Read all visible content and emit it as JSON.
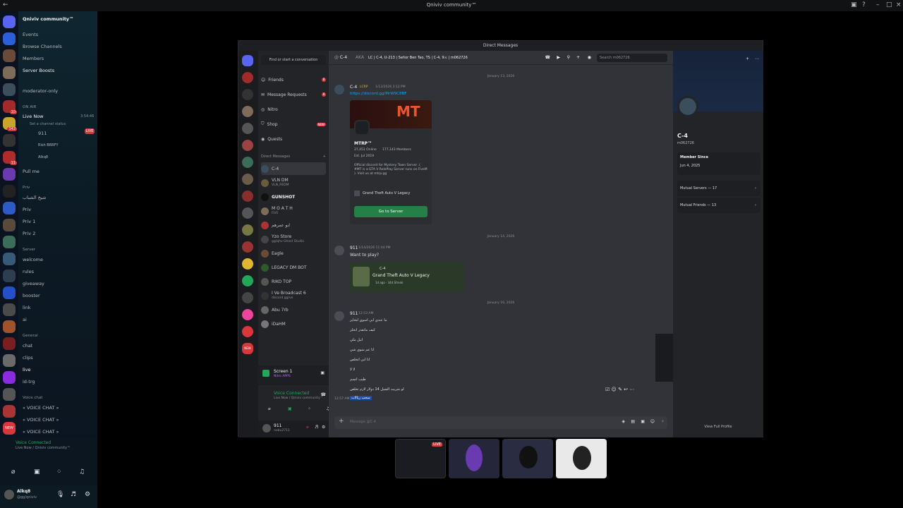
{
  "app": {
    "title": "Qniviv community™"
  },
  "server": {
    "name": "Qniviv community™"
  },
  "sidebar": {
    "top": [
      "Events",
      "Browse Channels",
      "Members",
      "Server Boosts"
    ],
    "boosts_badge": "1",
    "moderator": "moderator-only",
    "on_air_label": "ON AIR",
    "live_now": "Live Now",
    "live_time": "3:54:46",
    "set_status": "Set a channel status",
    "live_users": [
      "911",
      "Rish BRRFY",
      "Alkq8"
    ],
    "live_tag": "LIVE",
    "pull": "Pull me",
    "priv_label": "Priv",
    "priv_items": [
      "شيخ الشباب",
      "Priv",
      "Priv 1",
      "Priv 2"
    ],
    "server_label": "Server",
    "server_items": [
      "welcome",
      "rules",
      "giveaway",
      "booster",
      "link",
      "ai"
    ],
    "general_label": "General",
    "general_items": [
      "chat",
      "clips",
      "live",
      "id-trg"
    ],
    "voice_label": "Voice chat",
    "voice_items": [
      "« VOICE CHAT »",
      "« VOICE CHAT »",
      "« VOICE CHAT »"
    ],
    "new_badge": "NEW"
  },
  "voice_status": {
    "title": "Voice Connected",
    "sub": "Live Now / Qniviv community™"
  },
  "userbar": {
    "name": "Alkq8",
    "status": "@gg/qniviv"
  },
  "window": {
    "title": "Direct Messages"
  },
  "dm": {
    "search": "Find or start a conversation",
    "menu": [
      "Friends",
      "Message Requests",
      "Nitro",
      "Shop",
      "Quests"
    ],
    "shop_badge": "NEW",
    "friends_badge": "8",
    "requests_badge": "8",
    "dm_label": "Direct Messages",
    "items": [
      {
        "name": "C-4",
        "sub": ""
      },
      {
        "name": "VLN DM",
        "sub": "VLN_REDM"
      },
      {
        "name": "GUNSHOT",
        "sub": ""
      },
      {
        "name": "M O A T H",
        "sub": "FiVE"
      },
      {
        "name": "ابو عمرهم",
        "sub": ""
      },
      {
        "name": "Yzo Store",
        "sub": "gg/qhv Ghost Studio"
      },
      {
        "name": "Eagle",
        "sub": ""
      },
      {
        "name": "LEGACY DM BOT",
        "sub": ""
      },
      {
        "name": "RIKO TOP",
        "sub": ""
      },
      {
        "name": "I Ve Broadcast 6",
        "sub": "discord.gg/ve"
      },
      {
        "name": "Abu 7rb",
        "sub": ""
      },
      {
        "name": "iDaHM",
        "sub": ""
      }
    ],
    "screen_share": {
      "title": "Screen 1",
      "sub": "Nitro APPS"
    },
    "voice": {
      "title": "Voice Connected",
      "sub": "Live Now / Qniviv community™"
    },
    "me": {
      "name": "911",
      "tag": "nebu2711"
    }
  },
  "chat": {
    "header": {
      "name": "C-4",
      "aka": "AKA",
      "nicks": "LC | C-4, U-213 | Señor Ben Tao, TS | C-4, 9⚔ | m062726",
      "search": "Search m062726"
    },
    "dates": [
      "January 13, 2026",
      "January 14, 2026",
      "January 16, 2026"
    ],
    "m1": {
      "author": "C-4",
      "tag": "LCRP",
      "time": "1/13/2026 3:12 PM",
      "link": "https://discord.gg/MrW9C8BF"
    },
    "invite": {
      "banner": "MT",
      "name": "MTRP™",
      "online": "27,451 Online",
      "members": "177,143 Members",
      "est": "Est. Jul 2019",
      "desc": "Official discord for Mystery Town Server .( #MT is a GTA V RolePlay Server runs on FiveM ). Visit us at mtrp.gg",
      "game": "Grand Theft Auto V Legacy",
      "button": "Go to Server"
    },
    "m2": {
      "author": "911",
      "time": "1/14/2026 11:44 PM",
      "text": "Want to play?"
    },
    "activity": {
      "user": "C-4",
      "game": "Grand Theft Auto V Legacy",
      "meta": "1d ago · 34d Streak"
    },
    "m3": {
      "author": "911",
      "time": "12:53 AM",
      "lines": [
        "ما عندي ابي اسوي لتخايز",
        "كيف ماتقدر انخلز",
        "ابيل ملي",
        "انا عم سوي شي",
        "انا ابي اتخلص",
        "لا لا",
        "طيب انسم",
        "لو شريت الشيل 14 دولار لازم تخلص"
      ]
    },
    "m4": {
      "time": "12:57 AM",
      "text": "سحب ريالات"
    },
    "input_placeholder": "Message @C-4"
  },
  "profile": {
    "name": "C-4",
    "username": "m062726",
    "member_since_label": "Member Since",
    "member_since": "Jun 4, 2025",
    "mutual_servers": "Mutual Servers — 17",
    "mutual_friends": "Mutual Friends — 13",
    "view_full": "View Full Profile"
  },
  "dock": {
    "live": "LIVE"
  },
  "colors": {
    "accent": "#5865f2",
    "green": "#23a55a",
    "red": "#da373c"
  }
}
